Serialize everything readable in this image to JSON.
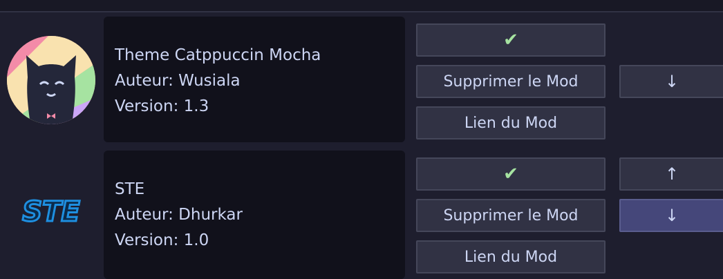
{
  "mods": [
    {
      "name": "Theme Catppuccin Mocha",
      "author": "Auteur: Wusiala",
      "version": "Version: 1.3",
      "enabled_icon": "check-icon",
      "enabled_glyph": "✔",
      "delete_label": "Supprimer le Mod",
      "link_label": "Lien du Mod",
      "move_down": "↓"
    },
    {
      "name": "STE",
      "author": "Auteur: Dhurkar",
      "version": "Version: 1.0",
      "logo_text": "STE",
      "enabled_icon": "check-icon",
      "enabled_glyph": "✔",
      "delete_label": "Supprimer le Mod",
      "link_label": "Lien du Mod",
      "move_up": "↑",
      "move_down": "↓"
    }
  ],
  "colors": {
    "background": "#1e1e2e",
    "panel": "#11111b",
    "button": "#313244",
    "check": "#a6e3a1",
    "highlight": "#45477a"
  }
}
